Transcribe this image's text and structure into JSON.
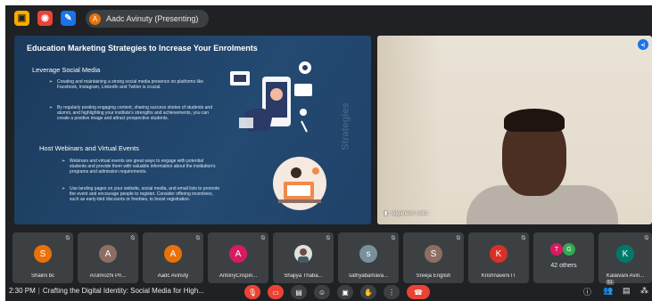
{
  "topbar": {
    "icons": [
      {
        "name": "activities-icon",
        "color": "#f9ab00"
      },
      {
        "name": "record-icon",
        "color": "#ea4335"
      },
      {
        "name": "whiteboard-icon",
        "color": "#1a73e8"
      }
    ],
    "presenter_initial": "A",
    "presenting_label": "Aadc Avinuty (Presenting)"
  },
  "slide": {
    "title": "Education Marketing Strategies to Increase Your Enrolments",
    "sections": [
      {
        "heading": "Leverage Social Media",
        "bullets": [
          "Creating and maintaining a strong social media presence on platforms like Facebook, Instagram, LinkedIn and Twitter is crucial.",
          "By regularly posting engaging content, sharing success stories of students and alumni, and highlighting your institute's strengths and achievements, you can create a positive image and attract prospective students."
        ]
      },
      {
        "heading": "Host Webinars and Virtual Events",
        "bullets": [
          "Webinars and virtual events are great ways to engage with potential students and provide them with valuable information about the institution's programs and admission requirements.",
          "Use landing pages on your website, social media, and email lists to promote the event and encourage people to register. Consider offering incentives, such as early-bird discounts or freebies, to boost registration."
        ]
      }
    ]
  },
  "speaker": {
    "name": "rajganesh roots"
  },
  "participants": [
    {
      "initial": "S",
      "name": "Shalini bc",
      "color": "#e8710a"
    },
    {
      "initial": "A",
      "name": "Arulmozhi Pri...",
      "color": "#8d6e63"
    },
    {
      "initial": "A",
      "name": "Aadc Avinuty",
      "color": "#e8710a"
    },
    {
      "initial": "A",
      "name": "AntonyCrispin...",
      "color": "#d81b60"
    },
    {
      "initial": "",
      "name": "Shajiya Thaba...",
      "color": "#e0e0e0"
    },
    {
      "initial": "s",
      "name": "sathyabamava...",
      "color": "#78909c"
    },
    {
      "initial": "S",
      "name": "Sreeja English",
      "color": "#8d6e63"
    },
    {
      "initial": "K",
      "name": "Krishnaveni IT",
      "color": "#d93025"
    },
    {
      "initial": "",
      "name": "42 others",
      "color": ""
    },
    {
      "initial": "K",
      "name": "Kalaivani Avin...",
      "color": "#00796b"
    }
  ],
  "others_badges": [
    {
      "initial": "T",
      "color": "#d81b60"
    },
    {
      "initial": "G",
      "color": "#34a853"
    }
  ],
  "bottombar": {
    "time": "2:30 PM",
    "meeting_title": "Crafting the Digital Identity: Social Media for High...",
    "people_count": "51"
  }
}
